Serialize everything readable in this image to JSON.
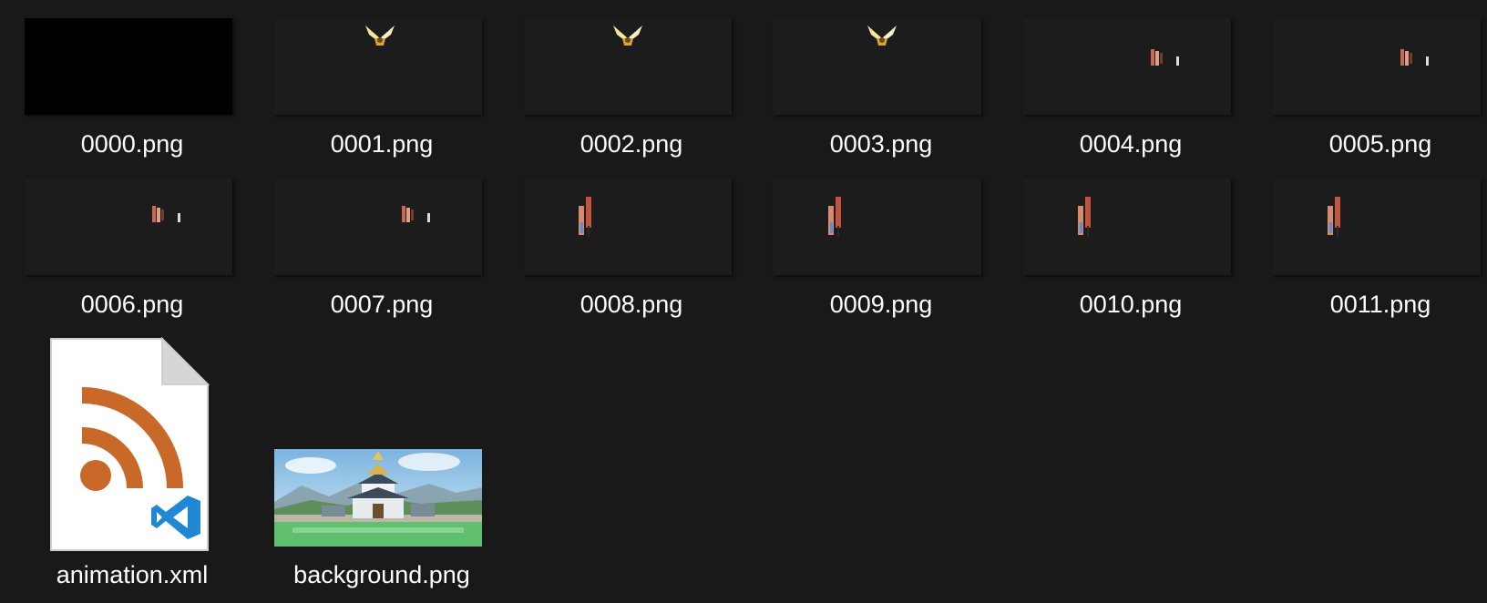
{
  "window": {
    "view": "Large icons",
    "background": "#191919"
  },
  "files": [
    {
      "name": "0000.png",
      "preview": "black"
    },
    {
      "name": "0001.png",
      "preview": "bird"
    },
    {
      "name": "0002.png",
      "preview": "bird"
    },
    {
      "name": "0003.png",
      "preview": "bird"
    },
    {
      "name": "0004.png",
      "preview": "small-sprites"
    },
    {
      "name": "0005.png",
      "preview": "small-sprites"
    },
    {
      "name": "0006.png",
      "preview": "small-sprites"
    },
    {
      "name": "0007.png",
      "preview": "small-sprites"
    },
    {
      "name": "0008.png",
      "preview": "tall-sprites"
    },
    {
      "name": "0009.png",
      "preview": "tall-sprites"
    },
    {
      "name": "0010.png",
      "preview": "tall-sprites"
    },
    {
      "name": "0011.png",
      "preview": "tall-sprites"
    },
    {
      "name": "animation.xml",
      "preview": "rss-xml-file-icon"
    },
    {
      "name": "background.png",
      "preview": "castle-landscape"
    }
  ],
  "colors": {
    "rss_orange": "#c8692a",
    "vscode_blue": "#1f87d3",
    "label_text": "#ffffff"
  }
}
